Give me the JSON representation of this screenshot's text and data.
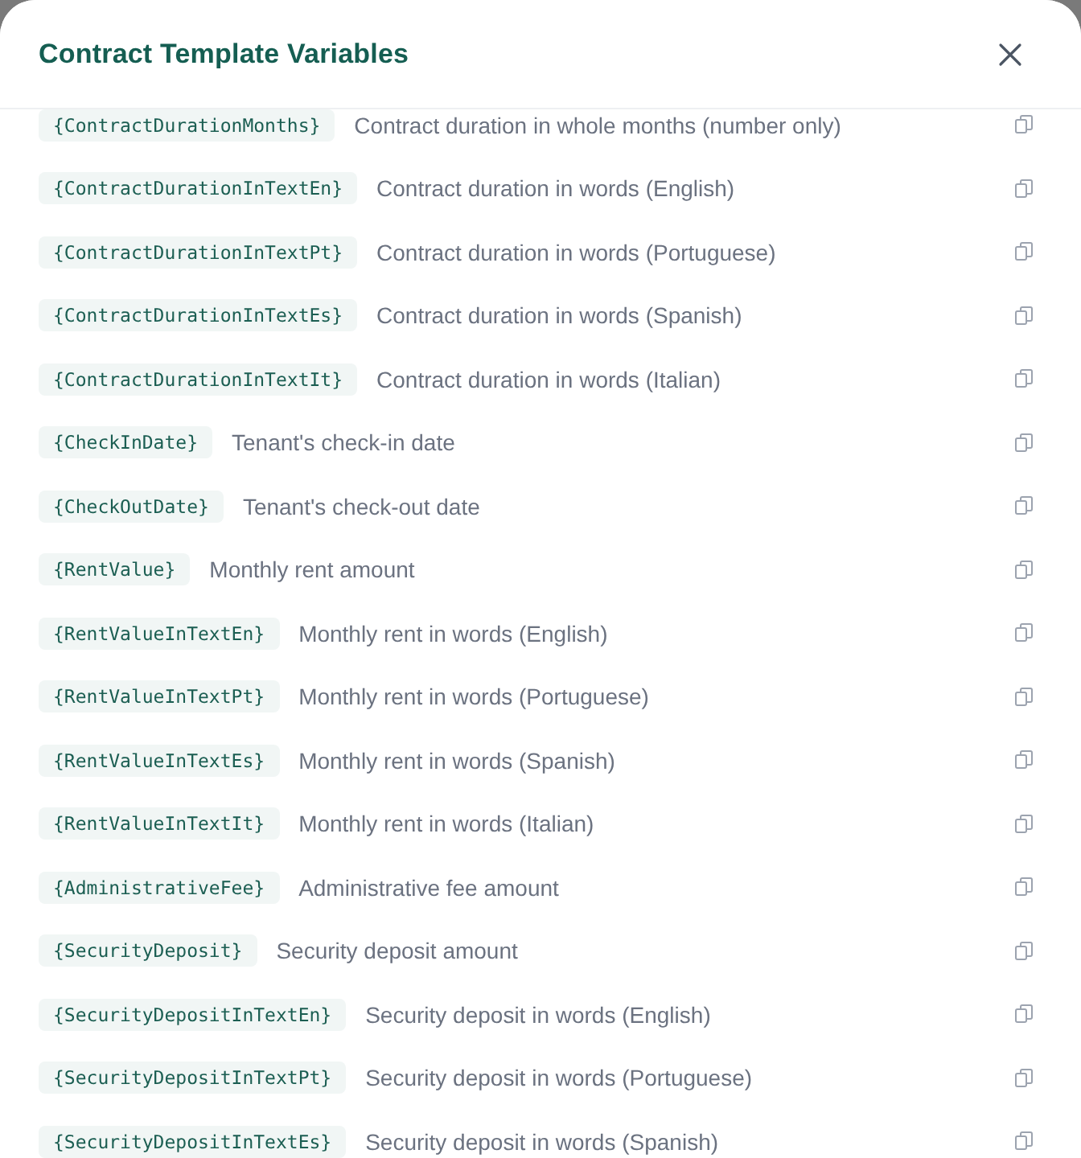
{
  "dialog": {
    "title": "Contract Template Variables"
  },
  "variables": [
    {
      "token": "{ContractDurationMonths}",
      "description": "Contract duration in whole months (number only)"
    },
    {
      "token": "{ContractDurationInTextEn}",
      "description": "Contract duration in words (English)"
    },
    {
      "token": "{ContractDurationInTextPt}",
      "description": "Contract duration in words (Portuguese)"
    },
    {
      "token": "{ContractDurationInTextEs}",
      "description": "Contract duration in words (Spanish)"
    },
    {
      "token": "{ContractDurationInTextIt}",
      "description": "Contract duration in words (Italian)"
    },
    {
      "token": "{CheckInDate}",
      "description": "Tenant's check-in date"
    },
    {
      "token": "{CheckOutDate}",
      "description": "Tenant's check-out date"
    },
    {
      "token": "{RentValue}",
      "description": "Monthly rent amount"
    },
    {
      "token": "{RentValueInTextEn}",
      "description": "Monthly rent in words (English)"
    },
    {
      "token": "{RentValueInTextPt}",
      "description": "Monthly rent in words (Portuguese)"
    },
    {
      "token": "{RentValueInTextEs}",
      "description": "Monthly rent in words (Spanish)"
    },
    {
      "token": "{RentValueInTextIt}",
      "description": "Monthly rent in words (Italian)"
    },
    {
      "token": "{AdministrativeFee}",
      "description": "Administrative fee amount"
    },
    {
      "token": "{SecurityDeposit}",
      "description": "Security deposit amount"
    },
    {
      "token": "{SecurityDepositInTextEn}",
      "description": "Security deposit in words (English)"
    },
    {
      "token": "{SecurityDepositInTextPt}",
      "description": "Security deposit in words (Portuguese)"
    },
    {
      "token": "{SecurityDepositInTextEs}",
      "description": "Security deposit in words (Spanish)"
    }
  ]
}
